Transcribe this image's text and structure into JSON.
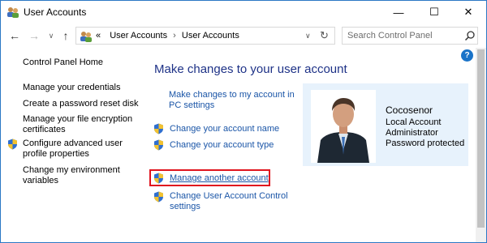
{
  "window": {
    "title": "User Accounts",
    "app_icon": "users-icon",
    "controls": {
      "minimize": "—",
      "maximize": "☐",
      "close": "✕"
    }
  },
  "nav": {
    "back": "←",
    "forward": "→",
    "recent": "∨",
    "up": "↑",
    "breadcrumb_prefix": "«",
    "breadcrumb": [
      "User Accounts",
      "User Accounts"
    ],
    "breadcrumb_sep": "›",
    "dropdown": "∨",
    "refresh": "↻",
    "search_placeholder": "Search Control Panel"
  },
  "help": {
    "label": "?"
  },
  "sidebar": {
    "home": "Control Panel Home",
    "items": [
      {
        "label": "Manage your credentials",
        "shield": false
      },
      {
        "label": "Create a password reset disk",
        "shield": false
      },
      {
        "label_lines": [
          "Manage your file encryption",
          "certificates"
        ],
        "shield": false
      },
      {
        "label_lines": [
          "Configure advanced user",
          "profile properties"
        ],
        "shield": true
      },
      {
        "label_lines": [
          "Change my environment",
          "variables"
        ],
        "shield": false
      }
    ]
  },
  "main": {
    "title": "Make changes to your user account",
    "pc_settings_link": [
      "Make changes to my account in",
      "PC settings"
    ],
    "links": [
      {
        "label": "Change your account name",
        "shield": true
      },
      {
        "label": "Change your account type",
        "shield": true
      },
      {
        "label": "Manage another account",
        "shield": true,
        "highlighted": true
      },
      {
        "label_lines": [
          "Change User Account Control",
          "settings"
        ],
        "shield": true
      }
    ]
  },
  "account": {
    "name": "Cocosenor",
    "lines": [
      "Local Account",
      "Administrator",
      "Password protected"
    ]
  },
  "colors": {
    "heading": "#1e3287",
    "link": "#1a55a7",
    "highlight": "#e0141e",
    "card_bg": "#e7f2fc"
  }
}
